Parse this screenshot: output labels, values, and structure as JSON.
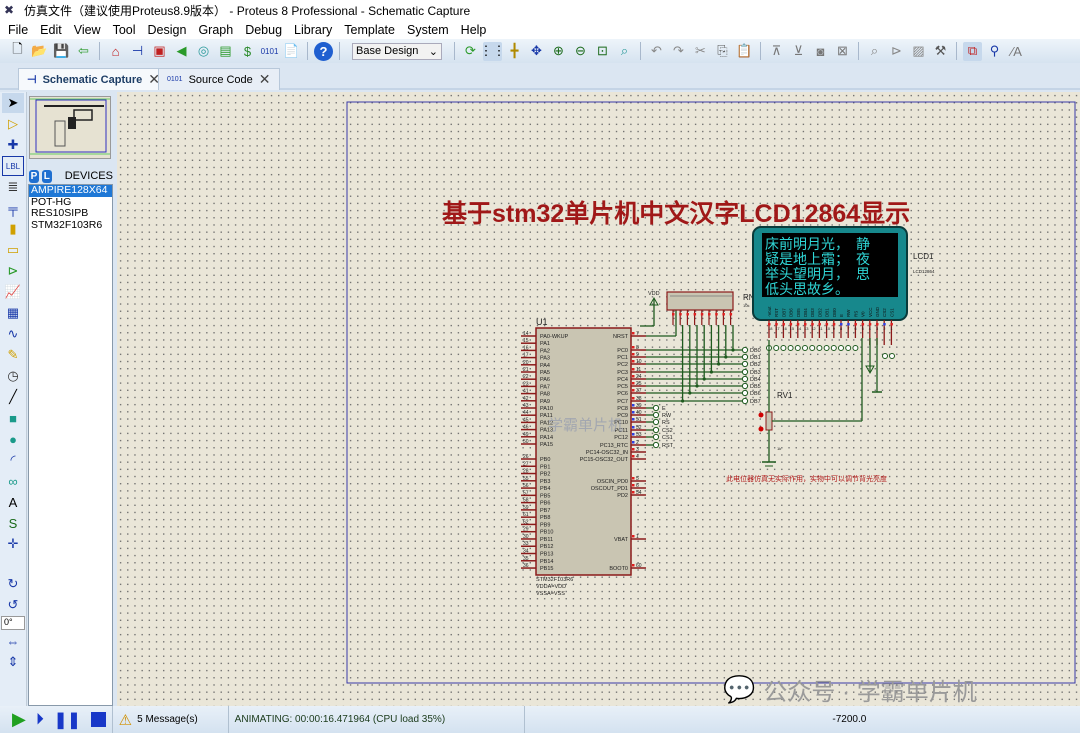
{
  "window": {
    "title": "仿真文件（建议使用Proteus8.9版本） - Proteus 8 Professional - Schematic Capture"
  },
  "menu": [
    "File",
    "Edit",
    "View",
    "Tool",
    "Design",
    "Graph",
    "Debug",
    "Library",
    "Template",
    "System",
    "Help"
  ],
  "toolbar": {
    "design_select": "Base Design"
  },
  "tabs": [
    {
      "label": "Schematic Capture",
      "active": true
    },
    {
      "label": "Source Code",
      "active": false
    }
  ],
  "devices": {
    "header": "DEVICES",
    "p": "P",
    "l": "L",
    "items": [
      "AMPIRE128X64",
      "POT-HG",
      "RES10SIPB",
      "STM32F103R6"
    ],
    "selected": "AMPIRE128X64"
  },
  "rotation": "0°",
  "schematic": {
    "title": "基于stm32单片机中文汉字LCD12864显示",
    "note": "此电位器仿真无实际作用，实物中可以调节背光亮度",
    "watermark": "学霸单片机",
    "u1": {
      "ref": "U1",
      "part": "STM32F103R6",
      "props": [
        "VDDA=VDD",
        "VSSA=VSS"
      ],
      "left_pins": [
        [
          "14",
          "PA0-WKUP"
        ],
        [
          "15",
          "PA1"
        ],
        [
          "16",
          "PA2"
        ],
        [
          "17",
          "PA3"
        ],
        [
          "20",
          "PA4"
        ],
        [
          "21",
          "PA5"
        ],
        [
          "22",
          "PA6"
        ],
        [
          "23",
          "PA7"
        ],
        [
          "41",
          "PA8"
        ],
        [
          "42",
          "PA9"
        ],
        [
          "43",
          "PA10"
        ],
        [
          "44",
          "PA11"
        ],
        [
          "45",
          "PA12"
        ],
        [
          "46",
          "PA13"
        ],
        [
          "49",
          "PA14"
        ],
        [
          "50",
          "PA15"
        ],
        [
          "26",
          "PB0"
        ],
        [
          "27",
          "PB1"
        ],
        [
          "28",
          "PB2"
        ],
        [
          "55",
          "PB3"
        ],
        [
          "56",
          "PB4"
        ],
        [
          "57",
          "PB5"
        ],
        [
          "58",
          "PB6"
        ],
        [
          "59",
          "PB7"
        ],
        [
          "61",
          "PB8"
        ],
        [
          "62",
          "PB9"
        ],
        [
          "29",
          "PB10"
        ],
        [
          "30",
          "PB11"
        ],
        [
          "33",
          "PB12"
        ],
        [
          "34",
          "PB13"
        ],
        [
          "35",
          "PB14"
        ],
        [
          "36",
          "PB15"
        ]
      ],
      "right_pins": [
        [
          "7",
          "NRST"
        ],
        [
          "8",
          "PC0"
        ],
        [
          "9",
          "PC1"
        ],
        [
          "10",
          "PC2"
        ],
        [
          "11",
          "PC3"
        ],
        [
          "24",
          "PC4"
        ],
        [
          "25",
          "PC5"
        ],
        [
          "37",
          "PC6"
        ],
        [
          "38",
          "PC7"
        ],
        [
          "39",
          "PC8"
        ],
        [
          "40",
          "PC9"
        ],
        [
          "51",
          "PC10"
        ],
        [
          "52",
          "PC11"
        ],
        [
          "53",
          "PC12"
        ],
        [
          "2",
          "PC13_RTC"
        ],
        [
          "3",
          "PC14-OSC32_IN"
        ],
        [
          "4",
          "PC15-OSC32_OUT"
        ],
        [
          "5",
          "OSCIN_PD0"
        ],
        [
          "6",
          "OSCOUT_PD1"
        ],
        [
          "54",
          "PD2"
        ],
        [
          "1",
          "VBAT"
        ],
        [
          "60",
          "BOOT0"
        ]
      ]
    },
    "net_db": [
      "DB0",
      "DB1",
      "DB2",
      "DB3",
      "DB4",
      "DB5",
      "DB6",
      "DB7"
    ],
    "net_ctrl": [
      "E",
      "RW",
      "RS",
      "CS2",
      "CS1",
      "RST"
    ],
    "lcd": {
      "ref": "LCD1",
      "part": "LCD12864",
      "lines": [
        "床前明月光，　静",
        "疑是地上霜；　夜",
        "举头望明月，　思",
        "低头思故乡。"
      ],
      "pins": [
        "-Vout",
        "RST",
        "DB7",
        "DB6",
        "DB5",
        "DB4",
        "DB3",
        "DB2",
        "DB1",
        "DB0",
        "E",
        "RW",
        "RS",
        "V0",
        "VCC",
        "GND",
        "CS2",
        "CS1"
      ],
      "pin_numbers": [
        "18",
        "17",
        "16",
        "15",
        "14",
        "13",
        "12",
        "11",
        "10",
        "9",
        "8",
        "7",
        "6",
        "5",
        "4",
        "3",
        "2",
        "1"
      ]
    },
    "rn1": {
      "ref": "RN1",
      "value": "10k"
    },
    "rv1": {
      "ref": "RV1",
      "value": "1k"
    },
    "vdd": "VDD"
  },
  "status": {
    "messages": "5 Message(s)",
    "animating": "ANIMATING: 00:00:16.471964 (CPU load 35%)",
    "coord": "-7200.0"
  },
  "watermark_bottom": "公众号 · 学霸单片机",
  "colors": {
    "wire": "#1e5a1e",
    "pin": "#8b1a1a",
    "title": "#a01818",
    "lcd_bg": "#17888c",
    "lcd_text": "#2fd6d6"
  }
}
